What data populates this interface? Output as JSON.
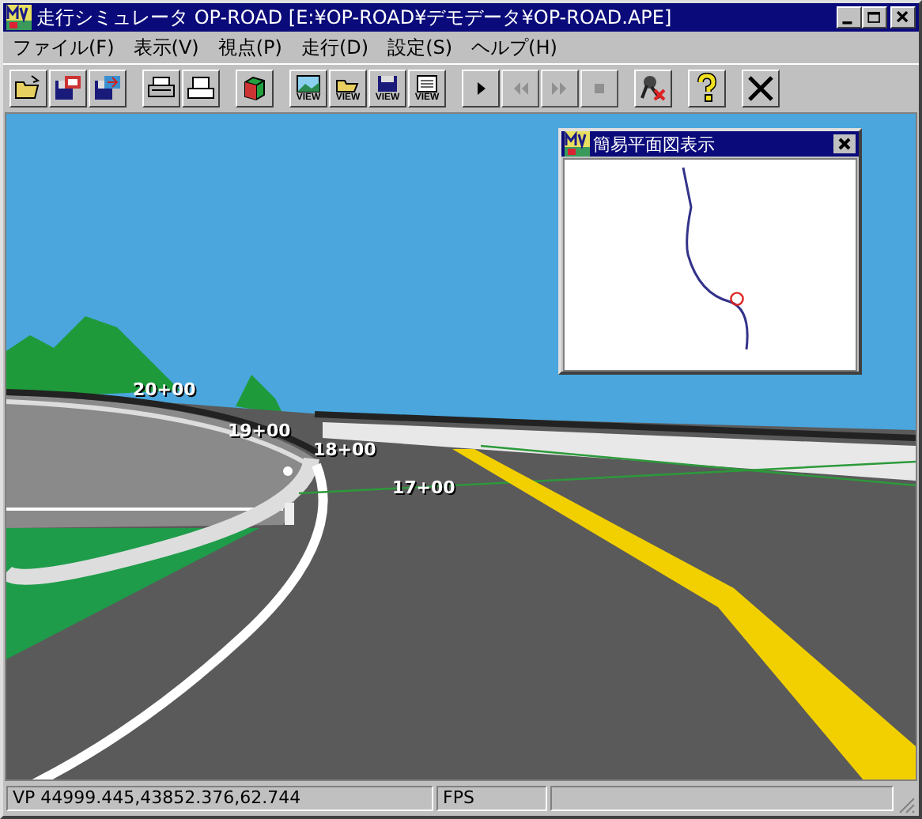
{
  "window": {
    "title": "走行シミュレータ OP-ROAD [E:¥OP-ROAD¥デモデータ¥OP-ROAD.APE]"
  },
  "menu": [
    {
      "label": "ファイル(F)"
    },
    {
      "label": "表示(V)"
    },
    {
      "label": "視点(P)"
    },
    {
      "label": "走行(D)"
    },
    {
      "label": "設定(S)"
    },
    {
      "label": "ヘルプ(H)"
    }
  ],
  "toolbar": [
    {
      "kind": "open",
      "disabled": false
    },
    {
      "kind": "import",
      "disabled": false
    },
    {
      "kind": "export",
      "disabled": false
    },
    {
      "kind": "sep"
    },
    {
      "kind": "print",
      "disabled": false
    },
    {
      "kind": "preview",
      "disabled": false
    },
    {
      "kind": "sep"
    },
    {
      "kind": "cube",
      "disabled": false
    },
    {
      "kind": "sep"
    },
    {
      "kind": "view",
      "label": "VIEW",
      "disabled": false
    },
    {
      "kind": "viewopen",
      "label": "VIEW",
      "disabled": false
    },
    {
      "kind": "viewsave",
      "label": "VIEW",
      "disabled": false
    },
    {
      "kind": "viewlist",
      "label": "VIEW",
      "disabled": false
    },
    {
      "kind": "sep"
    },
    {
      "kind": "play",
      "disabled": false
    },
    {
      "kind": "rewind",
      "disabled": true
    },
    {
      "kind": "forward",
      "disabled": true
    },
    {
      "kind": "stop",
      "disabled": true
    },
    {
      "kind": "sep"
    },
    {
      "kind": "tool",
      "disabled": false
    },
    {
      "kind": "sep"
    },
    {
      "kind": "help",
      "disabled": false
    },
    {
      "kind": "sep"
    },
    {
      "kind": "close",
      "disabled": false
    }
  ],
  "scene": {
    "station_labels": [
      "20+00",
      "19+00",
      "18+00",
      "17+00"
    ]
  },
  "plan_view": {
    "title": "簡易平面図表示"
  },
  "status_bar": {
    "position": "VP 44999.445,43852.376,62.744",
    "fps": "FPS"
  }
}
